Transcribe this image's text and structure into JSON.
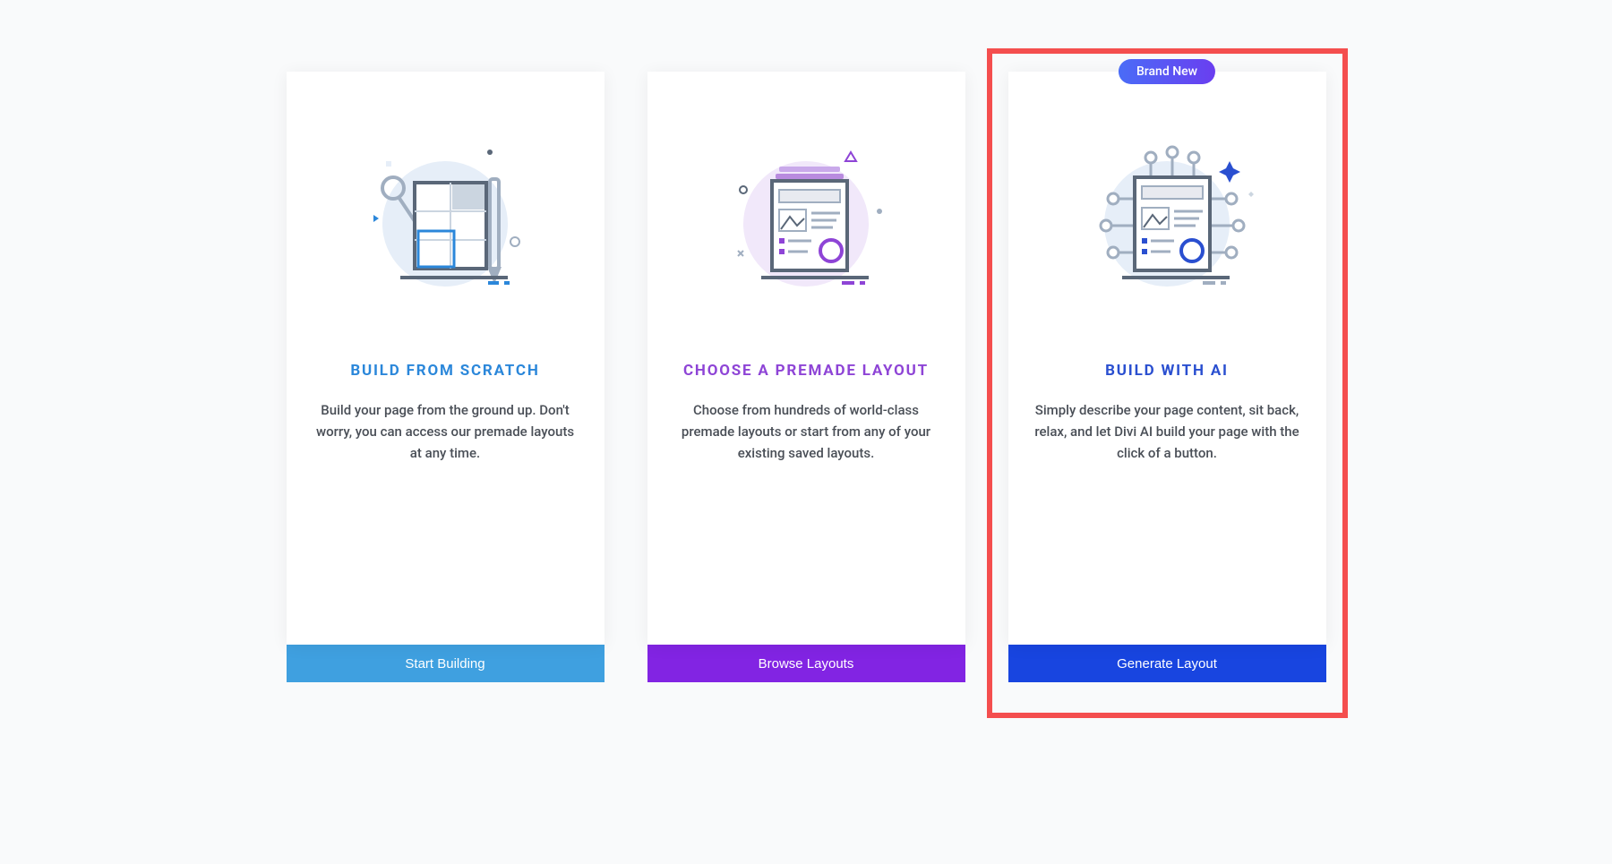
{
  "cards": [
    {
      "title": "BUILD FROM SCRATCH",
      "desc": "Build your page from the ground up. Don't worry, you can access our premade layouts at any time.",
      "cta": "Start Building"
    },
    {
      "title": "CHOOSE A PREMADE LAYOUT",
      "desc": "Choose from hundreds of world-class premade layouts or start from any of your existing saved layouts.",
      "cta": "Browse Layouts"
    },
    {
      "badge": "Brand New",
      "title": "BUILD WITH AI",
      "desc": "Simply describe your page content, sit back, relax, and let Divi AI build your page with the click of a button.",
      "cta": "Generate Layout"
    }
  ]
}
